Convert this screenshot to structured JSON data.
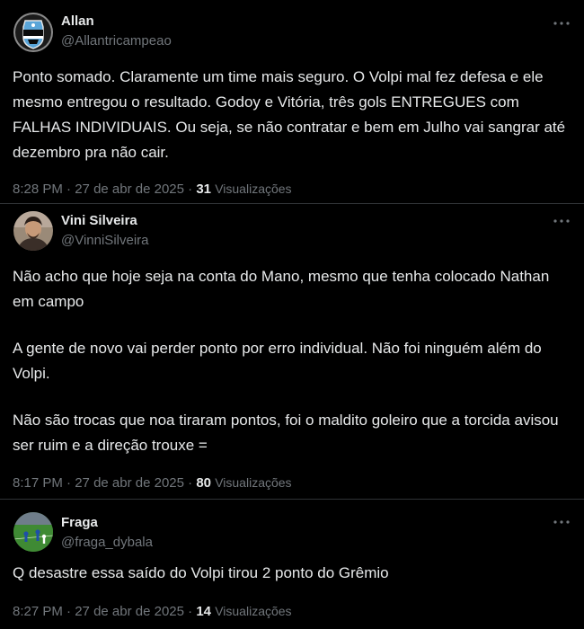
{
  "theme": {
    "background": "#000000",
    "text_primary": "#e7e9ea",
    "text_secondary": "#71767b",
    "divider": "#2f3336"
  },
  "tweets": [
    {
      "display_name": "Allan",
      "handle": "@Allantricampeao",
      "avatar_icon": "gremio-crest-avatar",
      "paragraphs": [
        "Ponto somado. Claramente um time mais seguro. O Volpi mal fez defesa e ele mesmo entregou o resultado. Godoy e Vitória, três gols ENTREGUES com FALHAS INDIVIDUAIS. Ou seja, se não contratar e bem em Julho vai sangrar até dezembro pra não cair."
      ],
      "time": "8:28 PM",
      "separator1": "·",
      "date": "27 de abr de 2025",
      "separator2": "·",
      "view_count": "31",
      "views_label": "Visualizações"
    },
    {
      "display_name": "Vini Silveira",
      "handle": "@VinniSilveira",
      "avatar_icon": "person-photo-avatar",
      "paragraphs": [
        "Não acho que hoje seja na conta do Mano, mesmo que tenha colocado Nathan em campo",
        "A gente de novo vai perder ponto por erro individual. Não foi ninguém além do Volpi.",
        "Não são trocas que noa tiraram pontos, foi o maldito goleiro que a torcida avisou ser ruim e a direção trouxe ="
      ],
      "time": "8:17 PM",
      "separator1": "·",
      "date": "27 de abr de 2025",
      "separator2": "·",
      "view_count": "80",
      "views_label": "Visualizações"
    },
    {
      "display_name": "Fraga",
      "handle": "@fraga_dybala",
      "avatar_icon": "football-field-avatar",
      "paragraphs": [
        "Q desastre essa saído do Volpi tirou 2 ponto do Grêmio"
      ],
      "time": "8:27 PM",
      "separator1": "·",
      "date": "27 de abr de 2025",
      "separator2": "·",
      "view_count": "14",
      "views_label": "Visualizações"
    }
  ],
  "icons": {
    "more": "more-options-icon"
  }
}
